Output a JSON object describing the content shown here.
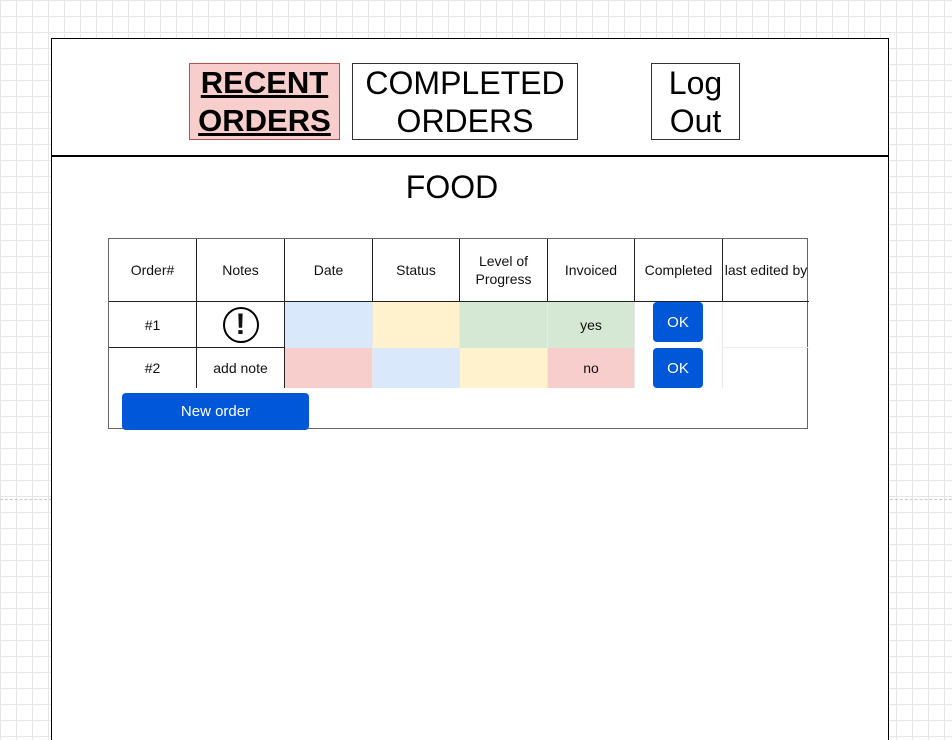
{
  "nav": {
    "recent_orders": "RECENT ORDERS",
    "completed_orders": "COMPLETED ORDERS",
    "log_out": "Log Out"
  },
  "page_title": "FOOD",
  "table": {
    "columns": [
      "Order#",
      "Notes",
      "Date",
      "Status",
      "Level of Progress",
      "Invoiced",
      "Completed",
      "last edited by"
    ],
    "rows": [
      {
        "order": "#1",
        "notes": "",
        "notes_icon": "exclamation-icon",
        "date_color": "#dae8fc",
        "status_color": "#fff2cc",
        "progress_color": "#d5e8d4",
        "invoiced": "yes",
        "invoiced_color": "#d5e8d4",
        "completed_button": "OK",
        "last_edited_by": ""
      },
      {
        "order": "#2",
        "notes": "add note",
        "date_color": "#f8cecc",
        "status_color": "#dae8fc",
        "progress_color": "#fff2cc",
        "invoiced": "no",
        "invoiced_color": "#f8cecc",
        "completed_button": "OK",
        "last_edited_by": ""
      }
    ]
  },
  "new_order_button": "New order",
  "colors": {
    "accent": "#0057d8",
    "active_tab": "#f8cecc"
  }
}
